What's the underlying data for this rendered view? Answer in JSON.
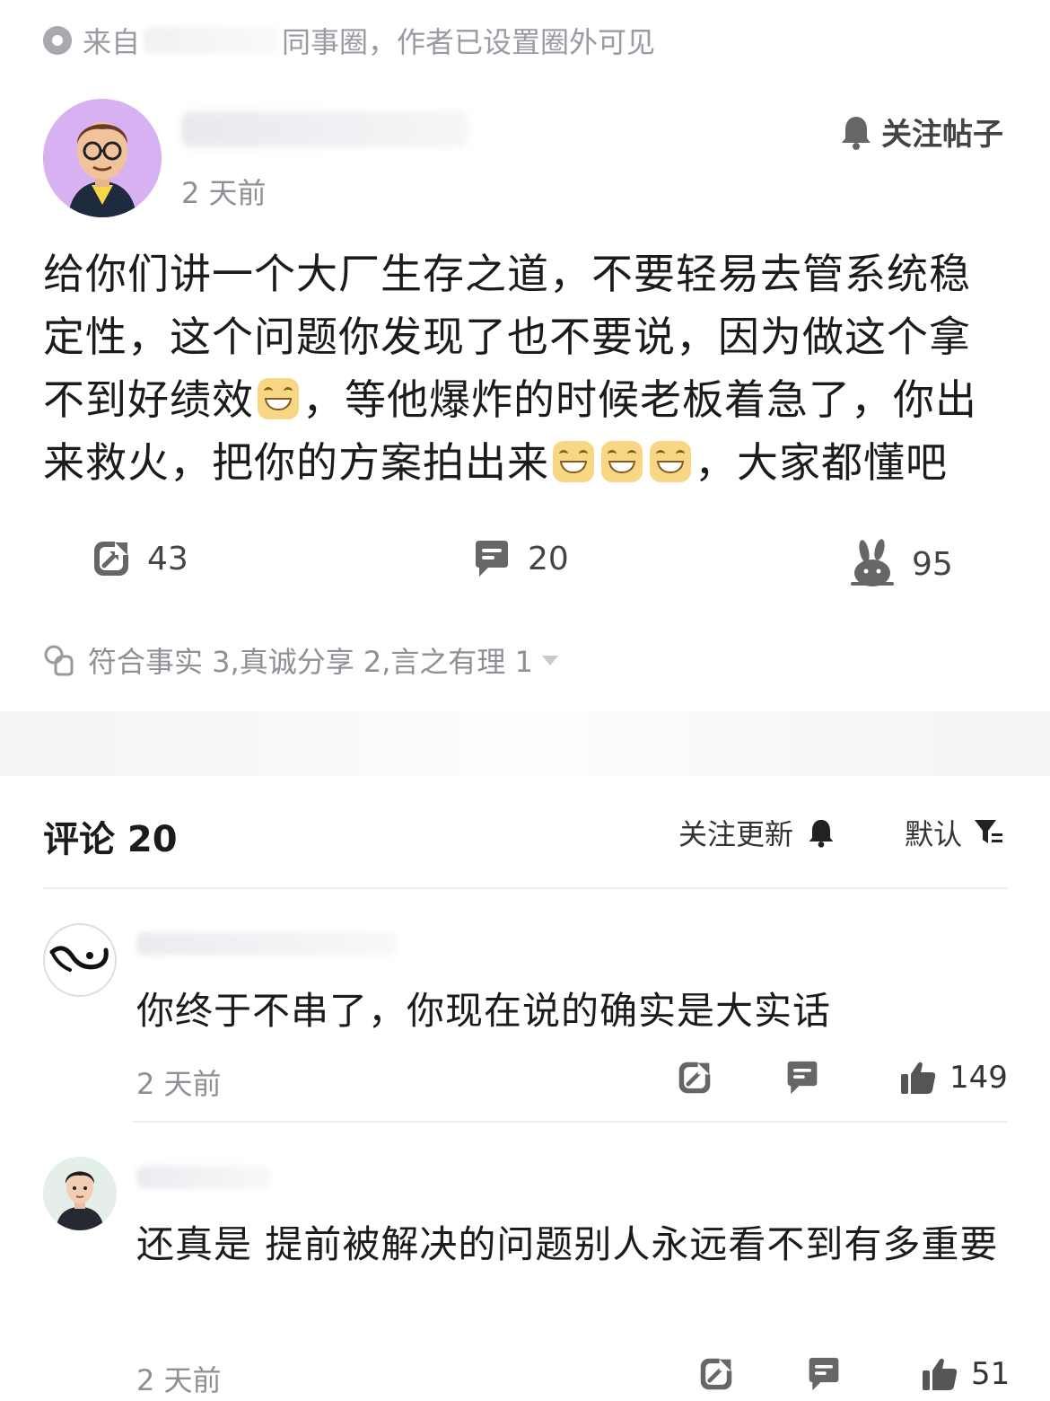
{
  "source_bar": {
    "prefix": "来自",
    "suffix": "同事圈，作者已设置圈外可见"
  },
  "post": {
    "time": "2 天前",
    "follow_label": "关注帖子",
    "body_segments": [
      "给你们讲一个大厂生存之道，不要轻易去管系统稳定性，这个问题你发现了也不要说，因为做这个拿不到好绩效",
      "，等他爆炸的时候老板着急了，你出来救火，把你的方案拍出来",
      "，大家都懂吧"
    ],
    "stats": {
      "shares": "43",
      "comments": "20",
      "likes": "95"
    },
    "reactions": "符合事实 3,真诚分享 2,言之有理 1"
  },
  "comments_section": {
    "title": "评论 20",
    "follow_update_label": "关注更新",
    "sort_label": "默认",
    "items": [
      {
        "text": "你终于不串了，你现在说的确实是大实话",
        "time": "2 天前",
        "likes": "149"
      },
      {
        "text": "还真是 提前被解决的问题别人永远看不到有多重要",
        "time": "2 天前",
        "likes": "51"
      }
    ]
  },
  "icons": {
    "source": "circle-dot-icon",
    "follow_post": "bell-icon",
    "share": "share-arrow-icon",
    "comment": "comment-bubble-icon",
    "like": "rabbit-icon",
    "reactions": "reaction-badge-icon",
    "follow_update": "bell-icon",
    "sort": "filter-icon",
    "comment_like": "thumbs-up-icon"
  }
}
